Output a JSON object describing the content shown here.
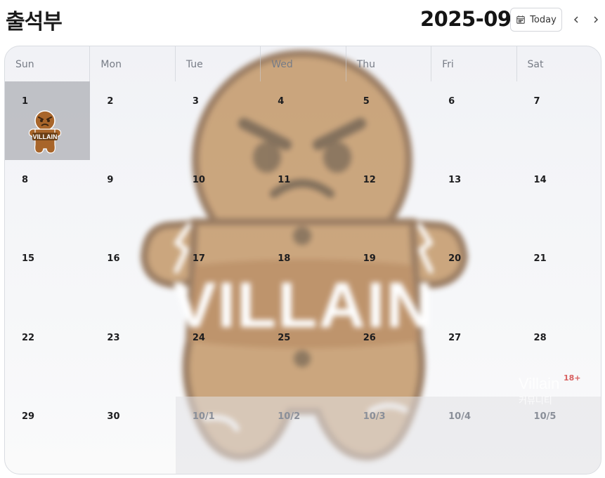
{
  "header": {
    "title": "출석부",
    "month": "2025-09",
    "today_label": "Today",
    "prev_icon": "chevron-left-icon",
    "next_icon": "chevron-right-icon",
    "calendar_icon": "calendar-icon"
  },
  "weekdays": [
    "Sun",
    "Mon",
    "Tue",
    "Wed",
    "Thu",
    "Fri",
    "Sat"
  ],
  "days": [
    {
      "label": "1",
      "checked": true
    },
    {
      "label": "2"
    },
    {
      "label": "3"
    },
    {
      "label": "4"
    },
    {
      "label": "5"
    },
    {
      "label": "6"
    },
    {
      "label": "7"
    },
    {
      "label": "8"
    },
    {
      "label": "9"
    },
    {
      "label": "10"
    },
    {
      "label": "11"
    },
    {
      "label": "12"
    },
    {
      "label": "13"
    },
    {
      "label": "14"
    },
    {
      "label": "15"
    },
    {
      "label": "16"
    },
    {
      "label": "17"
    },
    {
      "label": "18"
    },
    {
      "label": "19"
    },
    {
      "label": "20"
    },
    {
      "label": "21"
    },
    {
      "label": "22"
    },
    {
      "label": "23"
    },
    {
      "label": "24"
    },
    {
      "label": "25"
    },
    {
      "label": "26"
    },
    {
      "label": "27"
    },
    {
      "label": "28"
    },
    {
      "label": "29"
    },
    {
      "label": "30"
    },
    {
      "label": "10/1",
      "other": true
    },
    {
      "label": "10/2",
      "other": true
    },
    {
      "label": "10/3",
      "other": true
    },
    {
      "label": "10/4",
      "other": true
    },
    {
      "label": "10/5",
      "other": true
    }
  ],
  "background": {
    "mascot_text": "VILLAIN",
    "mascot_color": "#c49566"
  },
  "stamp": {
    "text": "VILLAIN"
  },
  "watermark": {
    "text": "Villain",
    "sub": "커뮤니티",
    "badge": "18+"
  }
}
